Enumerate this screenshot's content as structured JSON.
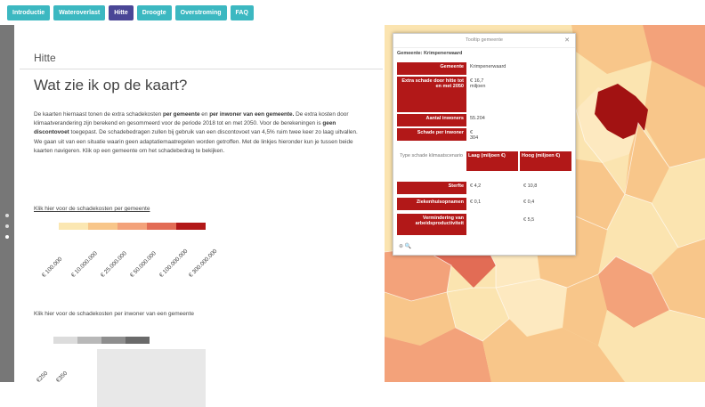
{
  "tabs": [
    {
      "label": "Introductie"
    },
    {
      "label": "Wateroverlast"
    },
    {
      "label": "Hitte"
    },
    {
      "label": "Droogte"
    },
    {
      "label": "Overstroming"
    },
    {
      "label": "FAQ"
    }
  ],
  "panel": {
    "title": "Hitte",
    "heading": "Wat zie ik op de kaart?",
    "paragraph": [
      {
        "t": "De kaarten hiernaast tonen de extra schadekosten "
      },
      {
        "t": "per gemeente",
        "b": true
      },
      {
        "t": " en "
      },
      {
        "t": "per inwoner van een gemeente.",
        "b": true
      },
      {
        "t": " De extra kosten door klimaatverandering zijn berekend en gesommeerd voor de periode 2018 tot en met 2050. Voor de berekeningen is "
      },
      {
        "t": "geen discontovoet",
        "b": true
      },
      {
        "t": " toegepast. De schadebedragen zullen bij gebruik van een discontovoet van 4,5% ruim twee keer zo laag uitvallen. We gaan uit van een situatie waarin geen adaptatiemaatregelen worden getroffen. Met de linkjes hieronder kun je tussen beide kaarten navigeren. Klik op een gemeente om het schadebedrag te bekijken."
      }
    ],
    "link1": "Klik hier voor de schadekosten per gemeente",
    "legend1_colors": [
      "#fbe7b2",
      "#f8c68a",
      "#f3a27a",
      "#e26c55",
      "#b21818"
    ],
    "legend1_ticks": [
      "€ 100.000",
      "€ 10.000.000",
      "€ 25.000.000",
      "€ 50.000.000",
      "€ 100.000.000",
      "€ 300.000.000"
    ],
    "link2": "Klik hier voor de schadekosten per inwoner van een gemeente",
    "legend2_colors": [
      "#dcdcdc",
      "#b8b8b8",
      "#8e8e8e",
      "#6a6a6a"
    ],
    "legend2_ticks": [
      "€250",
      "€350"
    ]
  },
  "popup": {
    "window_title": "Tooltip gemeente",
    "subtitle": "Gemeente: Krimpenerwaard",
    "rows": [
      {
        "label": "Gemeente",
        "value": "Krimpenerwaard"
      },
      {
        "label": "Extra schade door hitte tot en met 2050",
        "value": "€ 16,7 miljoen"
      },
      {
        "label": "Aantal inwoners",
        "value": "55.204"
      },
      {
        "label": "Schade per inwoner",
        "value": "€ 304"
      }
    ],
    "type_label": "Type schade klimaatscenario",
    "col1": "Laag (miljoen €)",
    "col2": "Hoog (miljoen €)",
    "type_rows": [
      {
        "label": "Sterfte",
        "v1": "€ 4,2",
        "v2": "€ 10,8"
      },
      {
        "label": "Ziekenhuisopnamen",
        "v1": "€ 0,1",
        "v2": "€ 0,4"
      },
      {
        "label": "Vermindering van arbeidsproductiviteit",
        "v1": "",
        "v2": "€ 5,5"
      }
    ],
    "footer": "⊕ 🔍"
  },
  "colors": {
    "tab": "#3cb8c1",
    "tab_active": "#4a4696",
    "accent_dark_red": "#b21818"
  }
}
